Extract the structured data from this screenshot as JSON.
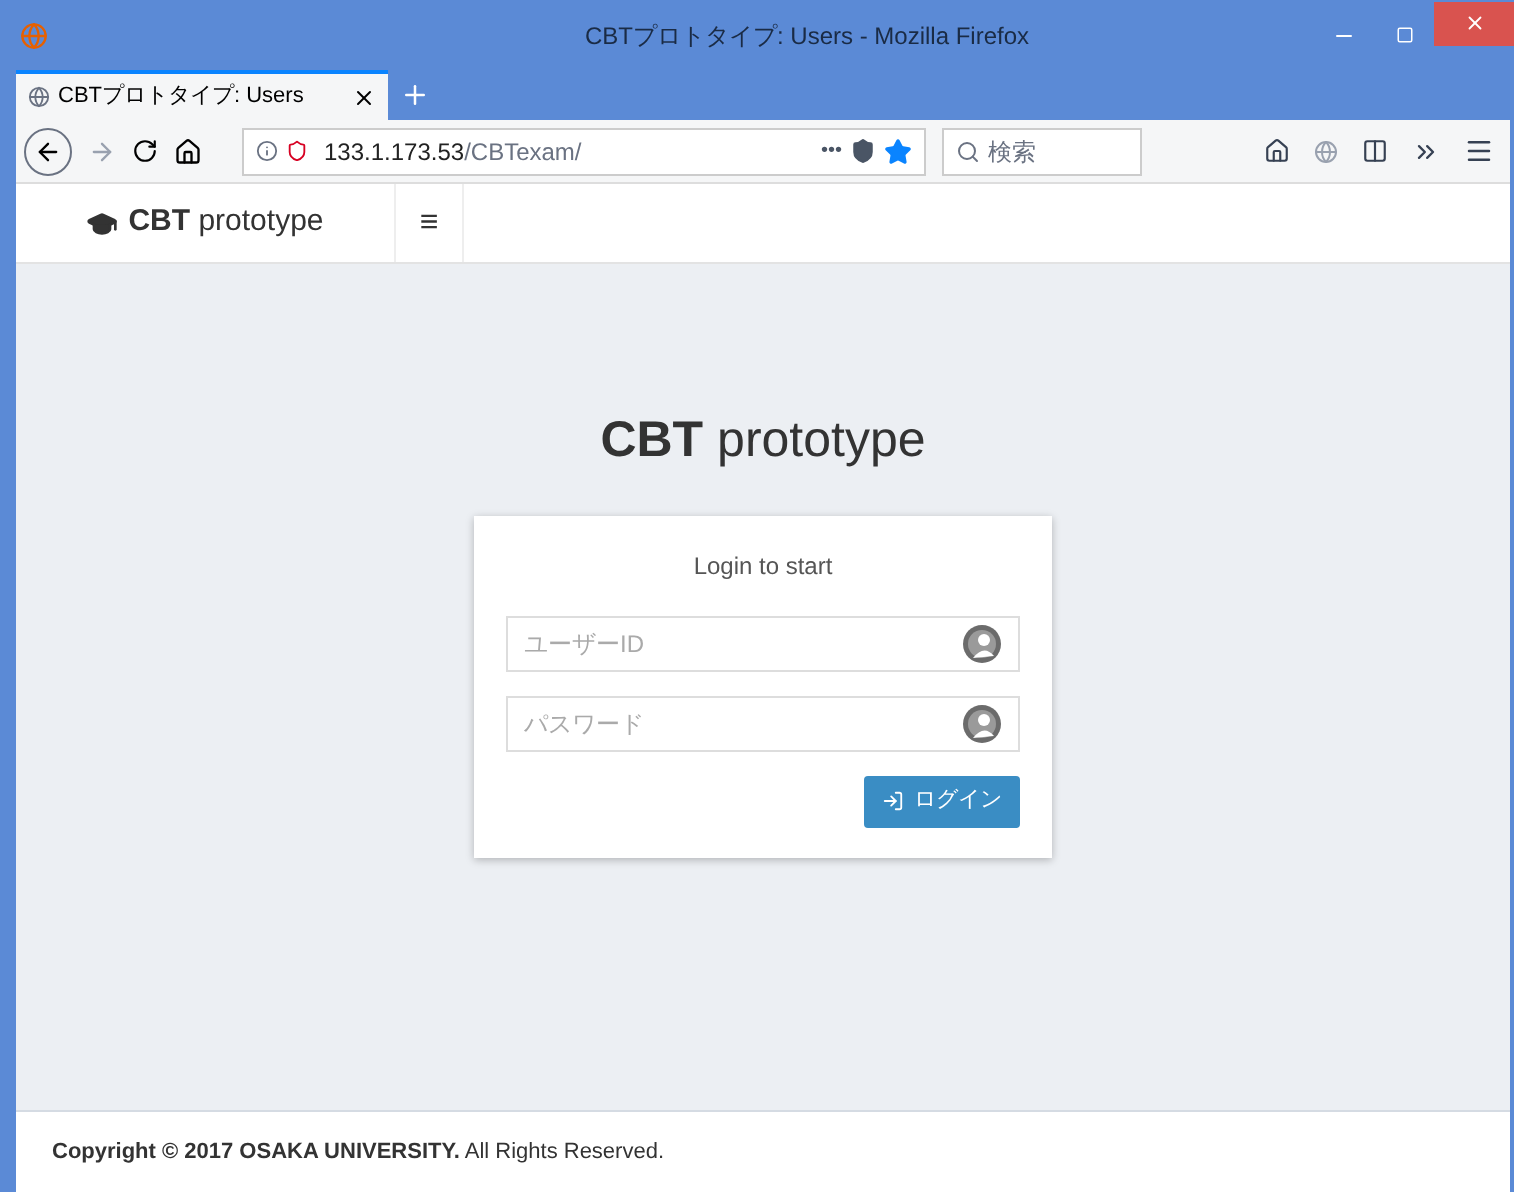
{
  "window": {
    "title": "CBTプロトタイプ: Users - Mozilla Firefox"
  },
  "tabs": [
    {
      "label": "CBTプロトタイプ: Users",
      "selected": true
    }
  ],
  "address_bar": {
    "host": "133.1.173.53",
    "path": "/CBTexam/",
    "more": "•••"
  },
  "search": {
    "placeholder": "検索"
  },
  "navbar": {
    "brand": "**CBT** prototype",
    "menu": "≡"
  },
  "login": {
    "heading": "**CBT** prototype",
    "prompt": "Login to start",
    "fields": [
      {
        "placeholder": "ユーザーID"
      },
      {
        "placeholder": "パスワード"
      }
    ],
    "button": "ログイン"
  },
  "footer": {
    "text": "**Copyright © 2017 OSAKA UNIVERSITY.** All Rights Reserved."
  }
}
